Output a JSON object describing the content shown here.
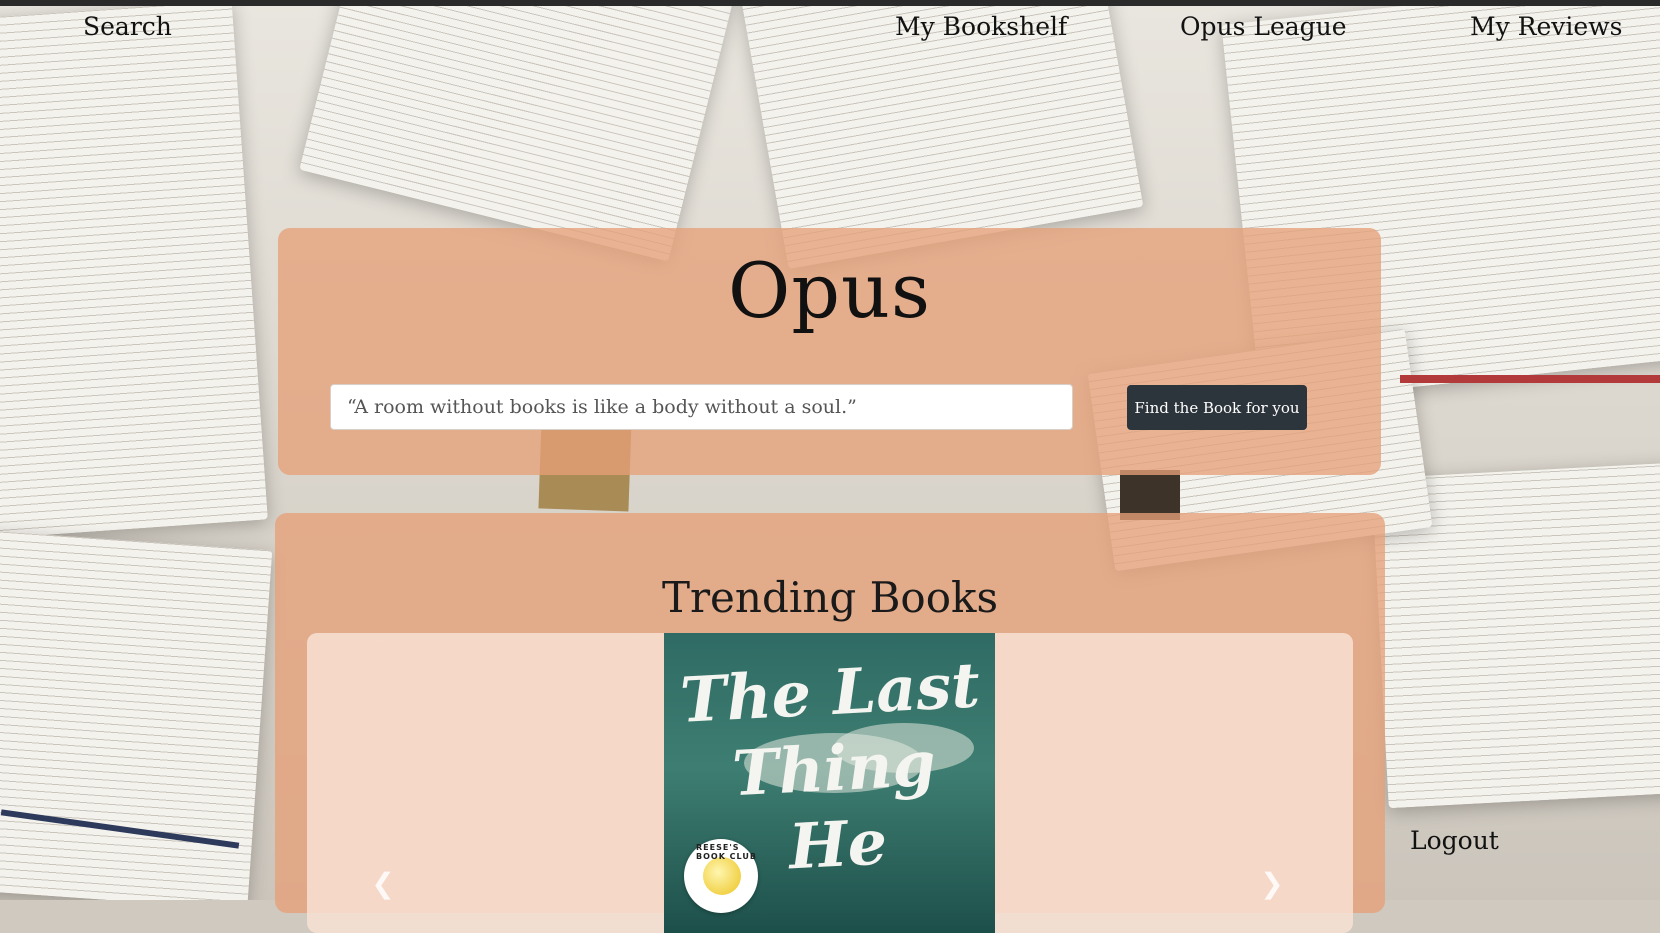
{
  "nav": {
    "search": "Search",
    "bookshelf": "My Bookshelf",
    "league": "Opus League",
    "reviews": "My Reviews"
  },
  "hero": {
    "title": "Opus",
    "quote_placeholder": "“A room without books is like a body without a soul.”",
    "find_button": "Find the Book for you"
  },
  "trending": {
    "title": "Trending Books",
    "book": {
      "cover_title": "The Last Thing He",
      "badge_text": "REESE'S BOOK CLUB"
    },
    "prev_icon": "chevron-left-icon",
    "next_icon": "chevron-right-icon"
  },
  "logout": "Logout",
  "colors": {
    "panel": "#e6a078",
    "button": "#2c343c",
    "cover": "#2f6b64"
  }
}
